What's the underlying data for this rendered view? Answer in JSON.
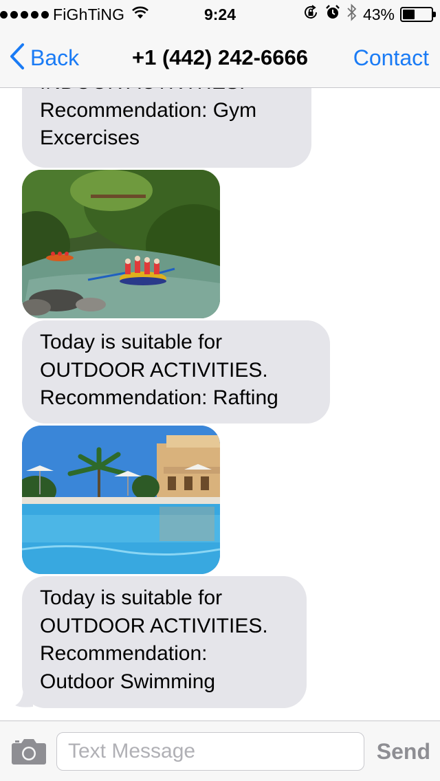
{
  "status_bar": {
    "carrier": "FiGhTiNG",
    "time": "9:24",
    "battery_percent": "43%",
    "battery_level": 0.43,
    "icons": [
      "signal-dots-icon",
      "wifi-icon",
      "rotation-lock-icon",
      "alarm-icon",
      "bluetooth-icon",
      "battery-icon"
    ]
  },
  "nav": {
    "back_label": "Back",
    "title": "+1 (442) 242-6666",
    "contact_label": "Contact",
    "accent_color": "#1a7bf5"
  },
  "messages": [
    {
      "type": "text",
      "lines": [
        "INDOOR ACTIVITIES.",
        "Recommendation: Gym",
        "Excercises"
      ]
    },
    {
      "type": "image",
      "icon": "rafting-photo"
    },
    {
      "type": "text",
      "lines": [
        "Today is suitable for",
        "OUTDOOR ACTIVITIES.",
        "Recommendation: Rafting"
      ]
    },
    {
      "type": "image",
      "icon": "pool-photo"
    },
    {
      "type": "text",
      "lines": [
        "Today is suitable for",
        "OUTDOOR ACTIVITIES.",
        "Recommendation:",
        "Outdoor Swimming"
      ]
    }
  ],
  "input": {
    "placeholder": "Text Message",
    "value": "",
    "send_label": "Send",
    "camera_icon": "camera-icon"
  },
  "colors": {
    "bubble_gray": "#e5e5ea",
    "bar_background": "#f7f7f7",
    "send_disabled": "#8e8e93"
  }
}
